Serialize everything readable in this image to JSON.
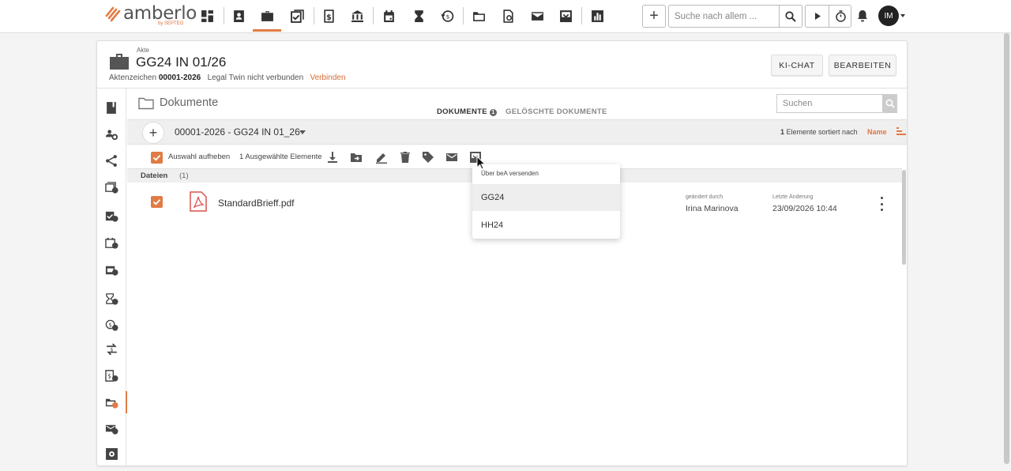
{
  "app": {
    "logo_text": "amberlo",
    "logo_sub": "by SEPTEO",
    "brand_color": "#e07b45"
  },
  "topbar": {
    "nav_icons": [
      "dashboard-icon",
      "contacts-icon",
      "briefcase-icon",
      "tasks-icon",
      "billing-icon",
      "court-icon",
      "calendar-icon",
      "hourglass-icon",
      "time-history-icon",
      "folder-icon",
      "documents-search-icon",
      "mail-icon",
      "inbox-icon",
      "reports-icon"
    ],
    "active_nav": "briefcase-icon",
    "search_placeholder": "Suche nach allem ...",
    "avatar_initials": "IM"
  },
  "header": {
    "label": "Akte",
    "title": "GG24 IN 01/26",
    "ref_label": "Aktenzeichen",
    "ref_value": "00001-2026",
    "legal_twin_text": "Legal Twin nicht verbunden",
    "connect_link": "Verbinden",
    "ki_chat_button": "KI-CHAT",
    "edit_button": "BEARBEITEN"
  },
  "sidebar": {
    "items": [
      "overview-icon",
      "participants-icon",
      "share-icon",
      "documents-count-icon",
      "tasks-count-icon",
      "calendar-count-icon",
      "appointments-count-icon",
      "time-count-icon",
      "billing-history-icon",
      "transfers-icon",
      "invoices-icon",
      "folder-active-icon",
      "mail-count-icon",
      "settings-icon"
    ],
    "active_item": "folder-active-icon"
  },
  "documents": {
    "title": "Dokumente",
    "tabs": [
      {
        "label": "DOKUMENTE",
        "badge": "1",
        "active": true
      },
      {
        "label": "GELÖSCHTE DOKUMENTE",
        "active": false
      }
    ],
    "search_placeholder": "Suchen",
    "path": "00001-2026 - GG24 IN 01_26",
    "sort_count": "1",
    "sort_text": "Elemente sortiert nach",
    "sort_field": "Name",
    "toolbar": {
      "deselect_label": "Auswahl aufheben",
      "selected_count_label": "1 Ausgewählte Elemente"
    },
    "files_section": {
      "label": "Dateien",
      "count": "(1)"
    },
    "files": [
      {
        "name": "StandardBrieff.pdf",
        "changed_by_label": "geändert durch",
        "changed_by": "Irina Marinova",
        "last_change_label": "Letzte Änderung",
        "last_change": "23/09/2026 10:44",
        "selected": true
      }
    ]
  },
  "dropdown": {
    "header": "Über beA versenden",
    "items": [
      "GG24",
      "HH24"
    ],
    "hovered": "GG24"
  }
}
